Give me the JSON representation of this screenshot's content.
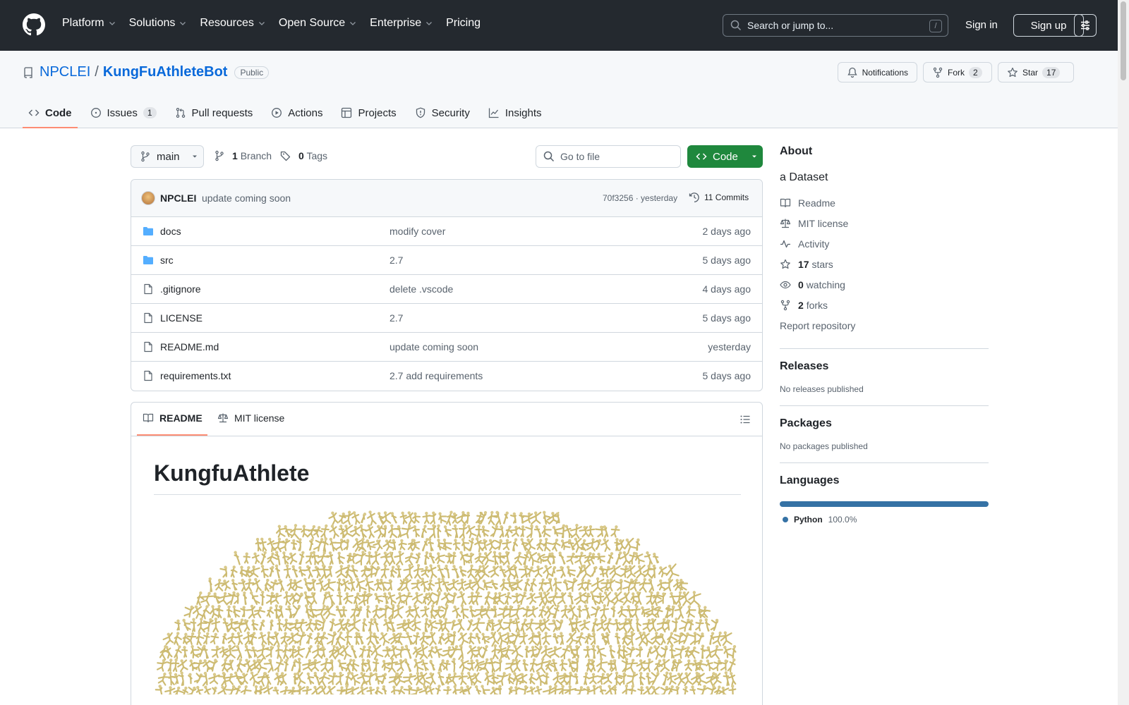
{
  "header": {
    "nav": [
      "Platform",
      "Solutions",
      "Resources",
      "Open Source",
      "Enterprise",
      "Pricing"
    ],
    "search_placeholder": "Search or jump to...",
    "search_shortcut": "/",
    "sign_in": "Sign in",
    "sign_up": "Sign up"
  },
  "repo": {
    "owner": "NPCLEI",
    "separator": "/",
    "name": "KungFuAthleteBot",
    "visibility": "Public",
    "notifications_label": "Notifications",
    "fork_label": "Fork",
    "fork_count": "2",
    "star_label": "Star",
    "star_count": "17",
    "tabs": [
      {
        "label": "Code",
        "count": ""
      },
      {
        "label": "Issues",
        "count": "1"
      },
      {
        "label": "Pull requests",
        "count": ""
      },
      {
        "label": "Actions",
        "count": ""
      },
      {
        "label": "Projects",
        "count": ""
      },
      {
        "label": "Security",
        "count": ""
      },
      {
        "label": "Insights",
        "count": ""
      }
    ]
  },
  "toolbar": {
    "branch": "main",
    "branch_count": "1",
    "branch_label": "Branch",
    "tag_count": "0",
    "tag_label": "Tags",
    "goto_placeholder": "Go to file",
    "code_label": "Code"
  },
  "commit": {
    "author": "NPCLEI",
    "message": "update coming soon",
    "hash_time": "70f3256 · yesterday",
    "commits_label": "11 Commits"
  },
  "files": [
    {
      "name": "docs",
      "type": "folder",
      "message": "modify cover",
      "date": "2 days ago"
    },
    {
      "name": "src",
      "type": "folder",
      "message": "2.7",
      "date": "5 days ago"
    },
    {
      "name": ".gitignore",
      "type": "file",
      "message": "delete .vscode",
      "date": "4 days ago"
    },
    {
      "name": "LICENSE",
      "type": "file",
      "message": "2.7",
      "date": "5 days ago"
    },
    {
      "name": "README.md",
      "type": "file",
      "message": "update coming soon",
      "date": "yesterday"
    },
    {
      "name": "requirements.txt",
      "type": "file",
      "message": "2.7 add requirements",
      "date": "5 days ago"
    }
  ],
  "readme": {
    "tab_readme": "README",
    "tab_license": "MIT license",
    "title": "KungfuAthlete"
  },
  "sidebar": {
    "about_title": "About",
    "description": "a Dataset",
    "readme": "Readme",
    "license": "MIT license",
    "activity": "Activity",
    "stars_count": "17",
    "stars_label": "stars",
    "watching_count": "0",
    "watching_label": "watching",
    "forks_count": "2",
    "forks_label": "forks",
    "report": "Report repository",
    "releases_title": "Releases",
    "releases_empty": "No releases published",
    "packages_title": "Packages",
    "packages_empty": "No packages published",
    "languages_title": "Languages",
    "language_name": "Python",
    "language_percent": "100.0%",
    "language_color": "#3572A5"
  }
}
